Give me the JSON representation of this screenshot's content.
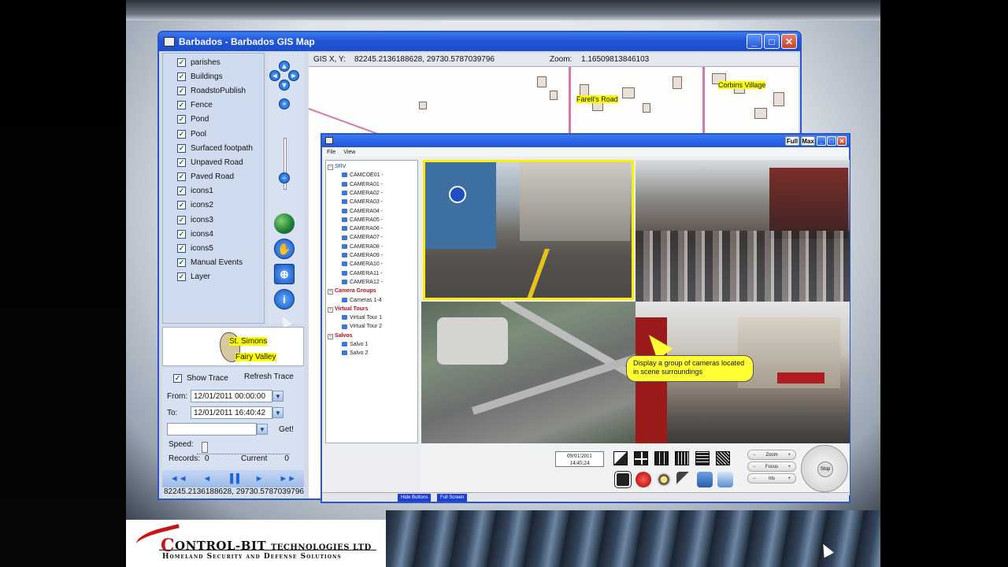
{
  "gis": {
    "title": "Barbados - Barbados GIS Map",
    "window_buttons": {
      "minimize": "_",
      "maximize": "□",
      "close": "✕"
    },
    "layers": [
      {
        "label": "parishes",
        "checked": true
      },
      {
        "label": "Buildings",
        "checked": true
      },
      {
        "label": "RoadstoPublish",
        "checked": true
      },
      {
        "label": "Fence",
        "checked": true
      },
      {
        "label": "Pond",
        "checked": true
      },
      {
        "label": "Pool",
        "checked": true
      },
      {
        "label": "Surfaced footpath",
        "checked": true
      },
      {
        "label": "Unpaved Road",
        "checked": true
      },
      {
        "label": "Paved Road",
        "checked": true
      },
      {
        "label": "icons1",
        "checked": true
      },
      {
        "label": "icons2",
        "checked": true
      },
      {
        "label": "icons3",
        "checked": true
      },
      {
        "label": "icons4",
        "checked": true
      },
      {
        "label": "icons5",
        "checked": true
      },
      {
        "label": "Manual Events",
        "checked": true
      },
      {
        "label": "Layer",
        "checked": true
      }
    ],
    "tools": [
      "pan-up-icon",
      "zoom-in-icon",
      "zoom-out-icon",
      "globe-icon",
      "hand-icon",
      "zoom-box-icon",
      "info-icon",
      "pointer-icon"
    ],
    "minimap_labels": {
      "a": "St. Simons",
      "b": "Fairy Valley"
    },
    "trace": {
      "show_trace_label": "Show Trace",
      "show_trace_checked": true,
      "refresh_trace_label": "Refresh Trace",
      "from_label": "From:",
      "from_value": "12/01/2011 00:00:00",
      "to_label": "To:",
      "to_value": "12/01/2011 16:40:42",
      "select_value": "",
      "get_label": "Get!",
      "speed_label": "Speed:",
      "records_label": "Records:",
      "records_value": "0",
      "current_label": "Current",
      "current_value": "0"
    },
    "player_buttons": [
      "◄◄",
      "◄",
      "▐▐",
      "►",
      "►►"
    ],
    "status": "82245.2136188628, 29730.5787039796",
    "map": {
      "gis_xy_label": "GIS X, Y:",
      "gis_xy_value": "82245.2136188628, 29730.5787039796",
      "zoom_label": "Zoom:",
      "zoom_value": "1.16509813846103",
      "labels": {
        "farells": "Farell's Road",
        "corbins": "Corbins Village"
      }
    }
  },
  "video": {
    "buttons": {
      "full": "Full",
      "max": "Max",
      "min": "_",
      "restore": "□",
      "close": "✕"
    },
    "menu": {
      "file": "File",
      "view": "View"
    },
    "tree": {
      "root": "SRV",
      "cameras": [
        "CAMCOE01 -",
        "CAMERA01 -",
        "CAMERA02 -",
        "CAMERA03 -",
        "CAMERA04 -",
        "CAMERA05 -",
        "CAMERA06 -",
        "CAMERA07 -",
        "CAMERA08 -",
        "CAMERA09 -",
        "CAMERA10 -",
        "CAMERA11 -",
        "CAMERA12 -"
      ],
      "groups_label": "Camera Groups",
      "groups": [
        "Cameras 1-4"
      ],
      "tours_label": "Virtual Tours",
      "tours": [
        "Virtual Tour 1",
        "Virtual Tour 2"
      ],
      "salvos_label": "Salvos",
      "salvos": [
        "Salvo 1",
        "Salvo 2"
      ]
    },
    "callout": "Display a group of cameras located in scene surroundings",
    "date": "09/01/2011",
    "time": "14:45:24",
    "ptz": {
      "zoom": "Zoom",
      "focus": "Focus",
      "iris": "Iris",
      "stop": "Stop"
    },
    "footer": {
      "hide_buttons": "Hide Buttons",
      "full_screen": "Full Screen"
    }
  },
  "logo": {
    "name_c": "C",
    "name_rest": "ONTROL-BIT",
    "name_tech": "TECHNOLOGIES LTD",
    "tagline": "Homeland Security and Defense Solutions",
    "accent_color": "#c91416"
  }
}
